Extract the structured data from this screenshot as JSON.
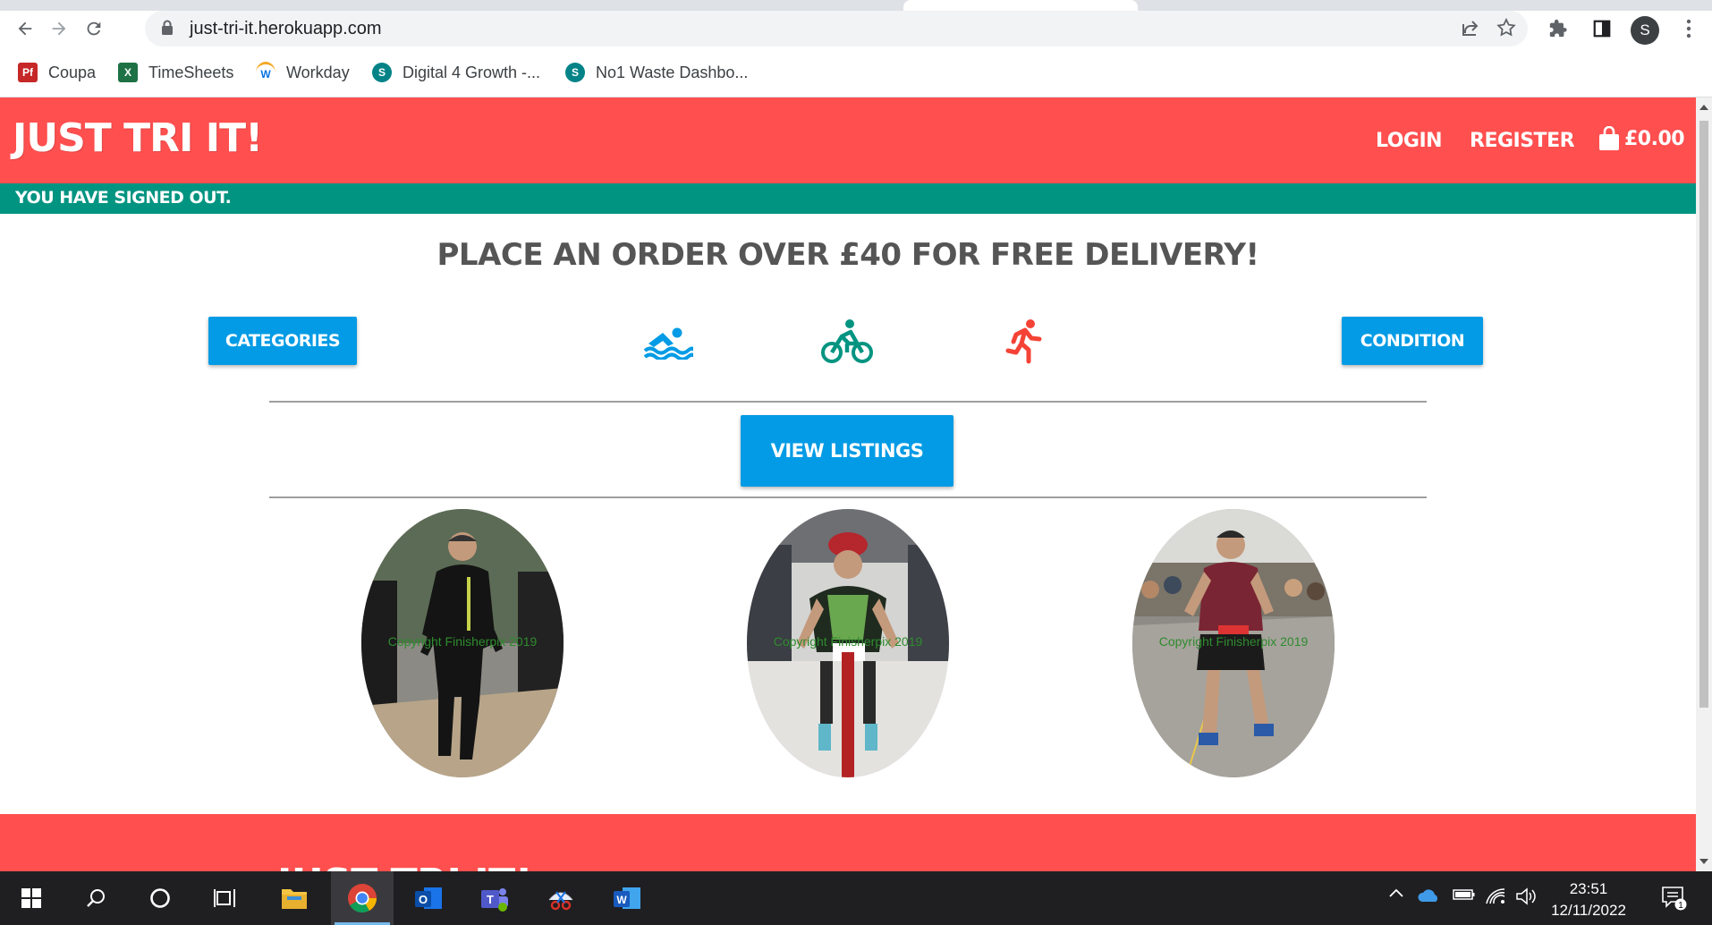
{
  "browser": {
    "url": "just-tri-it.herokuapp.com",
    "bookmarks": [
      {
        "label": "Coupa",
        "icon": "coupa-icon",
        "badge": "Pf",
        "color": "#c62828"
      },
      {
        "label": "TimeSheets",
        "icon": "excel-icon",
        "badge": "X",
        "color": "#1e7145"
      },
      {
        "label": "Workday",
        "icon": "workday-icon",
        "badge": "W",
        "color": "#0875e1"
      },
      {
        "label": "Digital 4 Growth -...",
        "icon": "sharepoint-icon",
        "badge": "S",
        "color": "#038387"
      },
      {
        "label": "No1 Waste Dashbo...",
        "icon": "sharepoint-icon",
        "badge": "S",
        "color": "#038387"
      }
    ],
    "profile_initial": "S"
  },
  "site": {
    "logo": "Just Tri It!",
    "nav": {
      "login": "Login",
      "register": "Register",
      "cart_total": "£0.00"
    },
    "flash_message": "You have signed out.",
    "promo": "Place an order over £40 for free delivery!",
    "buttons": {
      "categories": "Categories",
      "condition": "Condition",
      "view_listings": "View Listings"
    },
    "sports": [
      {
        "name": "swim",
        "icon": "swimming-icon",
        "color": "#039be5"
      },
      {
        "name": "bike",
        "icon": "cycling-icon",
        "color": "#009481"
      },
      {
        "name": "run",
        "icon": "running-icon",
        "color": "#f44336"
      }
    ],
    "photos": [
      {
        "caption": "Copyright Finisherpix 2019"
      },
      {
        "caption": "Copyright Finisherpix 2019"
      },
      {
        "caption": "Copyright Finisherpix 2019"
      }
    ],
    "footer_logo": "Just Tri It!",
    "colors": {
      "primary": "#ff4f4f",
      "teal": "#009481",
      "blue": "#039be5",
      "grey_text": "#555555"
    }
  },
  "taskbar": {
    "time": "23:51",
    "date": "12/11/2022",
    "notification_count": "1"
  }
}
